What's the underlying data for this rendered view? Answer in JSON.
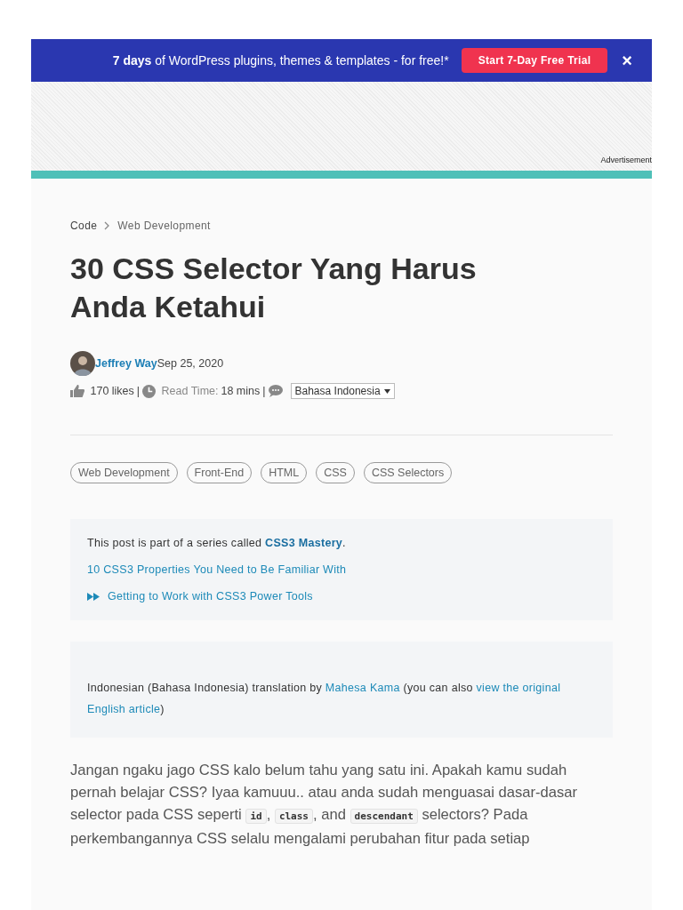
{
  "promo_banner": {
    "text": "**7 days** of WordPress plugins, themes & templates - for free!*",
    "button": "Start 7-Day Free Trial",
    "close": "×"
  },
  "advertisement": {
    "label": "Advertisement"
  },
  "breadcrumb": [
    "Code",
    "Web Development"
  ],
  "title": "30 CSS Selector Yang Harus Anda Ketahui",
  "author": {
    "name": "Jeffrey Way",
    "date": "Sep 25, 2020"
  },
  "meta": {
    "likes": "170 likes",
    "read_time_label": "Read Time:",
    "read_time": "18 mins",
    "language": "Bahasa Indonesia",
    "separators": [
      "|",
      "|"
    ]
  },
  "tags": [
    "Web Development",
    "Front-End",
    "HTML",
    "CSS",
    "CSS Selectors"
  ],
  "series": {
    "intro": "This post is part of a series called",
    "name": "CSS3 Mastery",
    "end": ".",
    "items": [
      {
        "title": "10 CSS3 Properties You Need to Be Familiar With",
        "current": false
      },
      {
        "title": "Getting to Work with CSS3 Power Tools",
        "current": true
      }
    ]
  },
  "translation": {
    "segments": [
      {
        "kind": "text",
        "text": "Indonesian (Bahasa Indonesia) translation by "
      },
      {
        "kind": "link",
        "text": "Mahesa Kama"
      },
      {
        "kind": "text",
        "text": " (you can also "
      },
      {
        "kind": "link",
        "text": "view the original"
      },
      {
        "kind": "link",
        "text": "English article",
        "new_line": true
      },
      {
        "kind": "text",
        "text": ")"
      }
    ]
  },
  "paragraph": [
    {
      "kind": "text",
      "text": "Jangan ngaku jago CSS kalo belum tahu yang satu ini. Apakah kamu sudah pernah belajar CSS? Iyaa kamuuu.. atau anda sudah menguasai dasar-dasar selector pada CSS seperti "
    },
    {
      "kind": "code",
      "text": "id"
    },
    {
      "kind": "text",
      "text": ", "
    },
    {
      "kind": "code",
      "text": "class"
    },
    {
      "kind": "text",
      "text": ", and "
    },
    {
      "kind": "code",
      "text": "descendant"
    },
    {
      "kind": "text",
      "text": " selectors? Pada perkembangannya CSS selalu mengalami perubahan fitur pada setiap"
    }
  ]
}
